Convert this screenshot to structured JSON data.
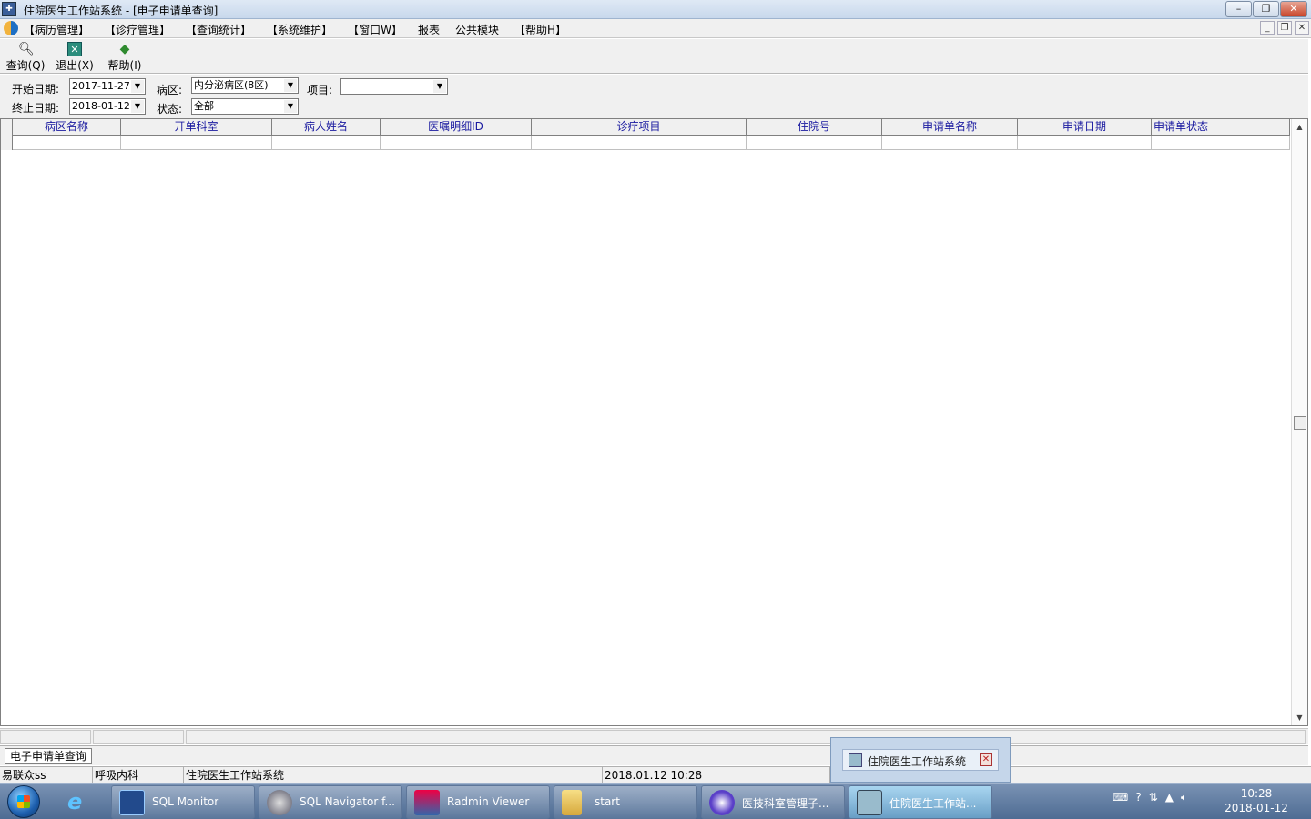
{
  "window": {
    "title": "住院医生工作站系统 - [电子申请单查询]",
    "controls": {
      "minimize": "–",
      "restore": "❐",
      "close": "✕"
    }
  },
  "menu": {
    "items": [
      "【病历管理】",
      "【诊疗管理】",
      "【查询统计】",
      "【系统维护】",
      "【窗口W】",
      "报表",
      "公共模块",
      "【帮助H】"
    ],
    "mdi_controls": {
      "minimize": "_",
      "restore": "❐",
      "close": "✕"
    }
  },
  "toolbar": {
    "query": "查询(Q)",
    "exit": "退出(X)",
    "help": "帮助(I)"
  },
  "filters": {
    "start_date_label": "开始日期:",
    "start_date_value": "2017-11-27",
    "end_date_label": "终止日期:",
    "end_date_value": "2018-01-12",
    "ward_label": "病区:",
    "ward_value": "内分泌病区(8区)",
    "status_label": "状态:",
    "status_value": "全部",
    "item_label": "项目:",
    "item_value": ""
  },
  "grid": {
    "columns": [
      "病区名称",
      "开单科室",
      "病人姓名",
      "医嘱明细ID",
      "诊疗项目",
      "住院号",
      "申请单名称",
      "申请日期",
      "申请单状态"
    ],
    "rows": []
  },
  "mdi_tab": "电子申请单查询",
  "status": {
    "user": "易联众ss",
    "department": "呼吸内科",
    "system": "住院医生工作站系统",
    "datetime": "2018.01.12 10:28"
  },
  "popup": {
    "title": "住院医生工作站系统"
  },
  "taskbar": {
    "tasks": [
      "SQL Monitor",
      "SQL Navigator f...",
      "Radmin Viewer",
      "start",
      "医技科室管理子...",
      "住院医生工作站..."
    ],
    "clock_time": "10:28",
    "clock_date": "2018-01-12"
  }
}
